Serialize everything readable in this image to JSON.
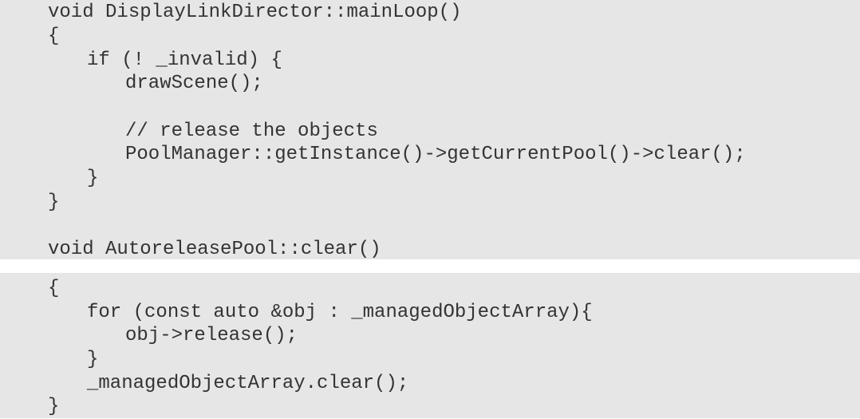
{
  "code_block_1": {
    "lines": [
      "void DisplayLinkDirector::mainLoop()",
      "{",
      "if (! _invalid) {",
      "drawScene();",
      "// release the objects",
      "PoolManager::getInstance()->getCurrentPool()->clear();",
      "}",
      "}",
      "void AutoreleasePool::clear()"
    ]
  },
  "code_block_2": {
    "lines": [
      "{",
      "for (const auto &obj : _managedObjectArray){",
      "obj->release();",
      "}",
      "_managedObjectArray.clear();",
      "}"
    ]
  },
  "colors": {
    "code_background": "#e6e6e6",
    "code_text": "#333333",
    "page_background": "#ffffff"
  }
}
